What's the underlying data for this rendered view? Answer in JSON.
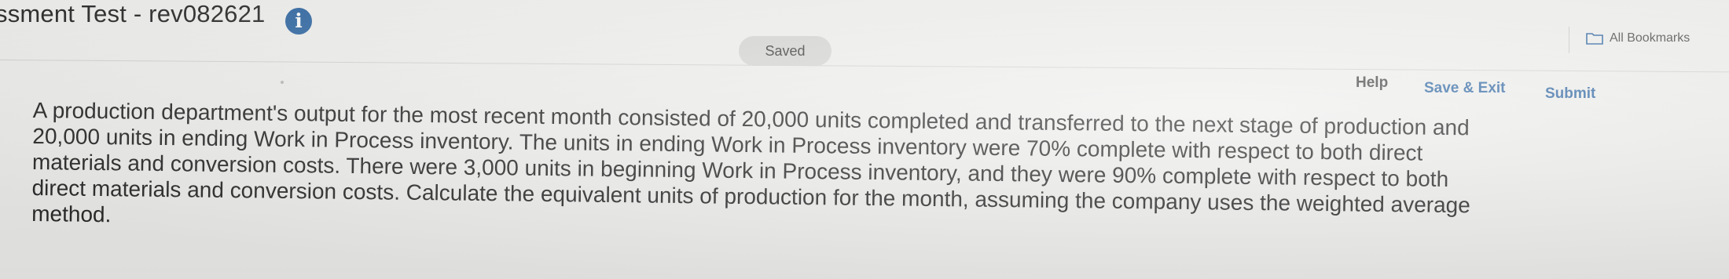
{
  "header": {
    "title": "ssment Test - rev082621",
    "info_icon": "info-icon",
    "saved_label": "Saved",
    "bookmarks_label": "All Bookmarks",
    "bookmarks_icon": "folder-icon"
  },
  "nav": {
    "help": "Help",
    "save_exit": "Save & Exit",
    "submit": "Submit"
  },
  "question": {
    "lines": [
      "A production department's output for the most recent month consisted of 20,000 units completed and transferred to the next stage of production and",
      "20,000 units in ending Work in Process inventory. The units in ending Work in Process inventory were 70% complete with respect to both direct",
      "materials and conversion costs. There were 3,000 units in beginning Work in Process inventory, and they were 90% complete with respect to both",
      "direct materials and conversion costs. Calculate the equivalent units of production for the month, assuming the company uses the weighted average",
      "method."
    ]
  },
  "colors": {
    "accent": "#3a6fa8",
    "text": "#2a2a2a"
  }
}
